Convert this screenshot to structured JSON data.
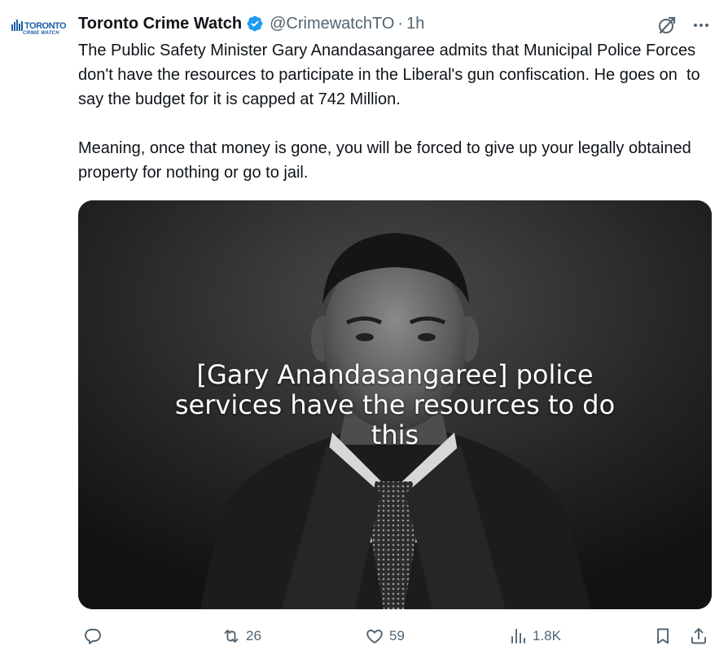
{
  "author": {
    "display_name": "Toronto Crime Watch",
    "handle": "@CrimewatchTO",
    "separator": "·",
    "time": "1h",
    "avatar_logo": {
      "top_text": "TORONTO",
      "bottom_text": "CRIME WATCH"
    }
  },
  "tweet": {
    "paragraphs": [
      "The Public Safety Minister Gary Anandasangaree admits that Municipal Police Forces don't have the resources to participate in the Liberal's gun confiscation. He goes on  to say the budget for it is capped at 742 Million.",
      "Meaning, once that money is gone, you will be forced to give up your legally obtained property for nothing or go to jail."
    ]
  },
  "media": {
    "caption": "[Gary Anandasangaree]  police\nservices have the resources to do\nthis"
  },
  "actions": {
    "reply_count": "",
    "retweet_count": "26",
    "like_count": "59",
    "views_count": "1.8K"
  },
  "icons": {
    "verified": "verified-badge-icon",
    "grok": "grok-icon",
    "more": "more-icon",
    "reply": "reply-icon",
    "retweet": "retweet-icon",
    "like": "heart-icon",
    "views": "views-icon",
    "bookmark": "bookmark-icon",
    "share": "share-icon"
  },
  "colors": {
    "text": "#0f1419",
    "secondary": "#536471",
    "verified": "#1d9bf0",
    "logo": "#1d5fa8"
  }
}
